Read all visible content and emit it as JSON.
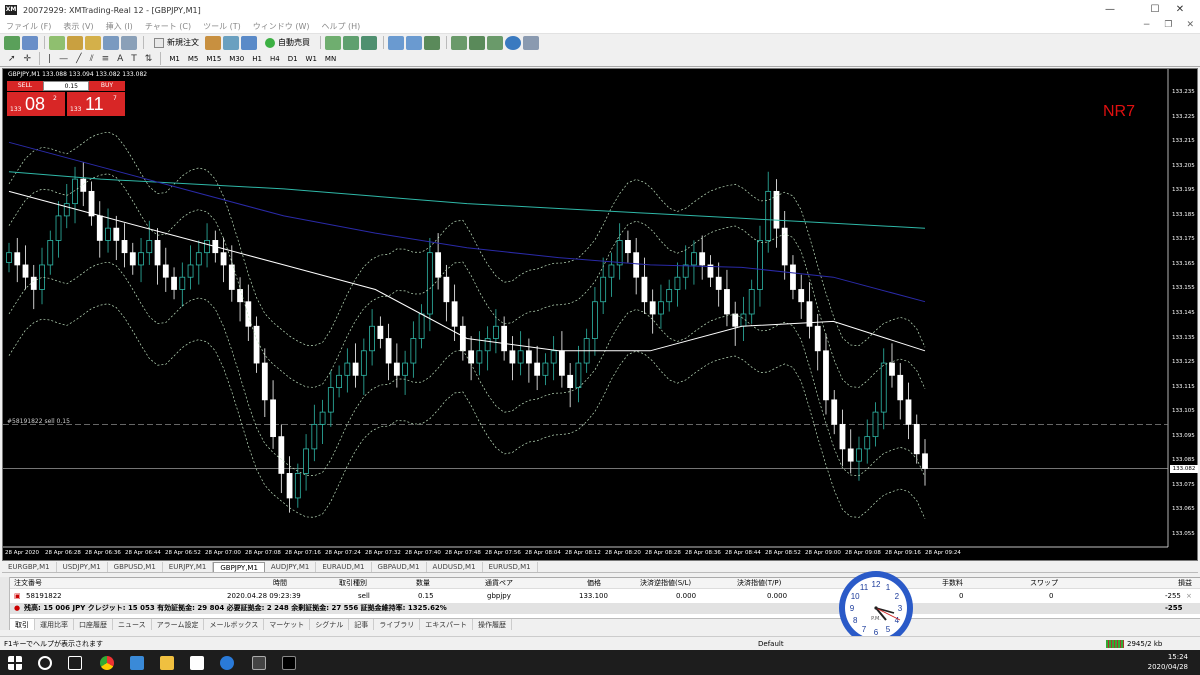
{
  "window": {
    "title": "20072929: XMTrading-Real 12 - [GBPJPY,M1]",
    "minimize": "—",
    "maximize": "☐",
    "close": "✕"
  },
  "menu": [
    "ファイル (F)",
    "表示 (V)",
    "挿入 (I)",
    "チャート (C)",
    "ツール (T)",
    "ウィンドウ (W)",
    "ヘルプ (H)"
  ],
  "toolbar": {
    "new_order": "新規注文",
    "auto_trade": "自動売買"
  },
  "timeframes": [
    "M1",
    "M5",
    "M15",
    "M30",
    "H1",
    "H4",
    "D1",
    "W1",
    "MN"
  ],
  "chart": {
    "symbol_label": "GBPJPY,M1  133.088 133.094 133.082 133.082",
    "indicator_label": "NR7",
    "order_line_label": "#58191822 sell 0.15",
    "current_price": "133.082",
    "trade_panel": {
      "sell": "SELL",
      "buy": "BUY",
      "lots": "0.15",
      "sell_small": "133",
      "sell_big": "08",
      "sell_sup": "2",
      "buy_small": "133",
      "buy_big": "11",
      "buy_sup": "7"
    },
    "colors": {
      "nr7": "#e01010",
      "ma_teal": "#2fb8a8",
      "ma_navy": "#2a2aa8",
      "ma_white": "#ffffff",
      "bollinger": "#bfe0bf",
      "bull": "#2fb8a8",
      "bear": "#ffffff"
    }
  },
  "chart_data": {
    "type": "candlestick",
    "symbol": "GBPJPY",
    "timeframe": "M1",
    "y_ticks": [
      "133.235",
      "133.225",
      "133.215",
      "133.205",
      "133.195",
      "133.185",
      "133.175",
      "133.165",
      "133.155",
      "133.145",
      "133.135",
      "133.125",
      "133.115",
      "133.105",
      "133.095",
      "133.085",
      "133.075",
      "133.065",
      "133.055"
    ],
    "x_ticks": [
      "28 Apr 2020",
      "28 Apr 06:28",
      "28 Apr 06:36",
      "28 Apr 06:44",
      "28 Apr 06:52",
      "28 Apr 07:00",
      "28 Apr 07:08",
      "28 Apr 07:16",
      "28 Apr 07:24",
      "28 Apr 07:32",
      "28 Apr 07:40",
      "28 Apr 07:48",
      "28 Apr 07:56",
      "28 Apr 08:04",
      "28 Apr 08:12",
      "28 Apr 08:20",
      "28 Apr 08:28",
      "28 Apr 08:36",
      "28 Apr 08:44",
      "28 Apr 08:52",
      "28 Apr 09:00",
      "28 Apr 09:08",
      "28 Apr 09:16",
      "28 Apr 09:24"
    ],
    "ylim": [
      133.05,
      133.24
    ],
    "last_price": 133.082,
    "order_price": 133.1,
    "close": [
      133.17,
      133.165,
      133.16,
      133.155,
      133.165,
      133.175,
      133.185,
      133.19,
      133.2,
      133.195,
      133.185,
      133.175,
      133.18,
      133.175,
      133.17,
      133.165,
      133.17,
      133.175,
      133.165,
      133.16,
      133.155,
      133.16,
      133.165,
      133.17,
      133.175,
      133.17,
      133.165,
      133.155,
      133.15,
      133.14,
      133.125,
      133.11,
      133.095,
      133.08,
      133.07,
      133.08,
      133.09,
      133.1,
      133.105,
      133.115,
      133.12,
      133.125,
      133.12,
      133.13,
      133.14,
      133.135,
      133.125,
      133.12,
      133.125,
      133.135,
      133.145,
      133.17,
      133.16,
      133.15,
      133.14,
      133.13,
      133.125,
      133.13,
      133.135,
      133.14,
      133.13,
      133.125,
      133.13,
      133.125,
      133.12,
      133.125,
      133.13,
      133.12,
      133.115,
      133.125,
      133.135,
      133.15,
      133.16,
      133.165,
      133.175,
      133.17,
      133.16,
      133.15,
      133.145,
      133.15,
      133.155,
      133.16,
      133.165,
      133.17,
      133.165,
      133.16,
      133.155,
      133.145,
      133.14,
      133.145,
      133.155,
      133.175,
      133.195,
      133.18,
      133.165,
      133.155,
      133.15,
      133.14,
      133.13,
      133.11,
      133.1,
      133.09,
      133.085,
      133.09,
      133.095,
      133.105,
      133.125,
      133.12,
      133.11,
      133.1,
      133.088,
      133.082
    ],
    "series": [
      {
        "name": "MA teal",
        "values": [
          133.203,
          133.2,
          133.198,
          133.196,
          133.193,
          133.19,
          133.188,
          133.186,
          133.184,
          133.182,
          133.18
        ]
      },
      {
        "name": "MA navy",
        "values": [
          133.215,
          133.205,
          133.195,
          133.185,
          133.178,
          133.172,
          133.168,
          133.165,
          133.164,
          133.16,
          133.15
        ]
      },
      {
        "name": "MA white",
        "values": [
          133.195,
          133.185,
          133.175,
          133.165,
          133.155,
          133.135,
          133.13,
          133.13,
          133.14,
          133.142,
          133.13
        ]
      }
    ]
  },
  "symbol_tabs": [
    "EURGBP,M1",
    "USDJPY,M1",
    "GBPUSD,M1",
    "EURJPY,M1",
    "GBPJPY,M1",
    "AUDJPY,M1",
    "EURAUD,M1",
    "GBPAUD,M1",
    "AUDUSD,M1",
    "EURUSD,M1"
  ],
  "active_symbol_tab": "GBPJPY,M1",
  "terminal": {
    "headers": {
      "order": "注文番号",
      "time": "時間",
      "type": "取引種別",
      "volume": "数量",
      "symbol": "通貨ペア",
      "price": "価格",
      "sl": "決済逆指値(S/L)",
      "tp": "決済指値(T/P)",
      "commission": "手数料",
      "swap": "スワップ",
      "profit": "損益"
    },
    "row": {
      "order": "58191822",
      "time": "2020.04.28 09:23:39",
      "type": "sell",
      "volume": "0.15",
      "symbol": "gbpjpy",
      "price": "133.100",
      "sl": "0.000",
      "tp": "0.000",
      "commission": "0",
      "swap": "0",
      "profit": "-255"
    },
    "summary": "残高: 15 006 JPY  クレジット: 15 053  有効証拠金: 29 804  必要証拠金: 2 248  余剰証拠金: 27 556  証拠金維持率: 1325.62%",
    "summary_profit": "-255",
    "tabs": [
      "取引",
      "運用比率",
      "口座履歴",
      "ニュース",
      "アラーム設定",
      "メールボックス",
      "マーケット",
      "シグナル",
      "記事",
      "ライブラリ",
      "エキスパート",
      "操作履歴"
    ]
  },
  "status": {
    "help": "F1キーでヘルプが表示されます",
    "profile": "Default",
    "traffic": "2945/2 kb"
  },
  "taskbar": {
    "time": "15:24",
    "date": "2020/04/28"
  }
}
